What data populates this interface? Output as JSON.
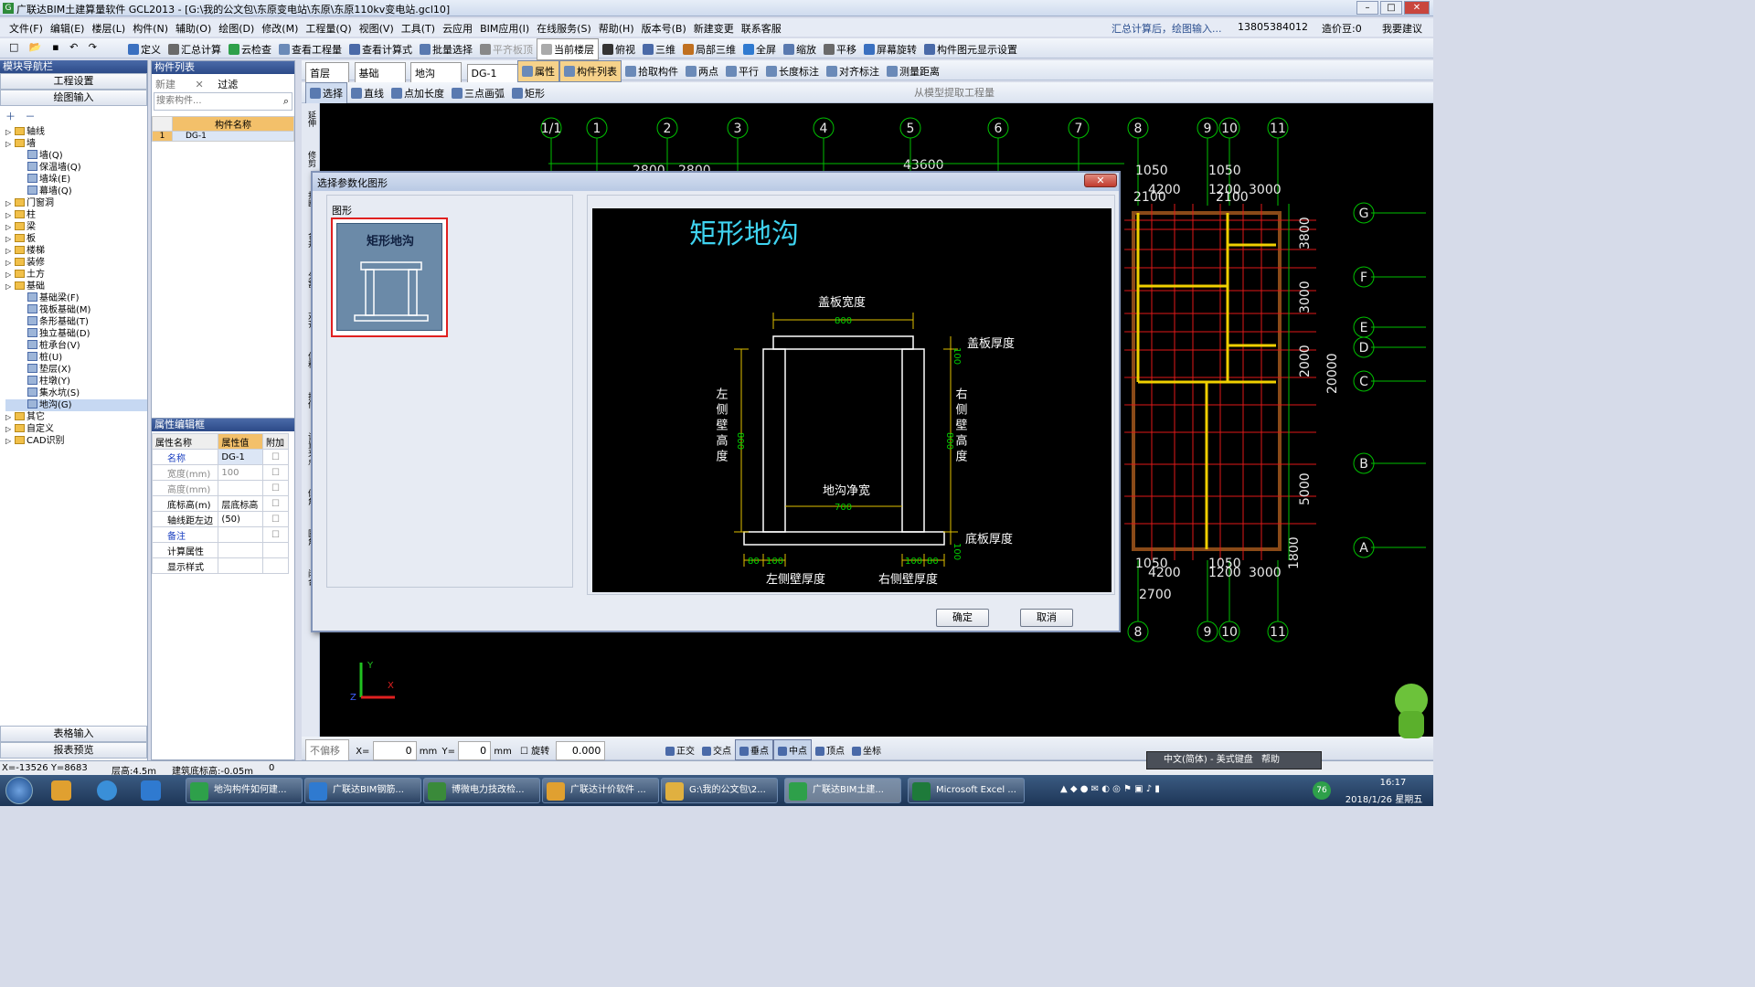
{
  "app": {
    "title": "广联达BIM土建算量软件 GCL2013 - [G:\\我的公文包\\东原变电站\\东原\\东原110kv变电站.gcl10]",
    "window_controls": [
      "–",
      "□",
      "✕"
    ]
  },
  "menu": [
    "文件(F)",
    "编辑(E)",
    "楼层(L)",
    "构件(N)",
    "辅助(O)",
    "绘图(D)",
    "修改(M)",
    "工程量(Q)",
    "视图(V)",
    "工具(T)",
    "云应用",
    "BIM应用(I)",
    "在线服务(S)",
    "帮助(H)",
    "版本号(B)",
    "新建变更",
    "联系客服"
  ],
  "menu_right": {
    "hint": "汇总计算后，绘图输入...",
    "phone": "13805384012",
    "money": "造价豆:0",
    "feedback": "我要建议"
  },
  "toolbar1": [
    "定义",
    "汇总计算",
    "云检查",
    "查看工程量",
    "查看计算式",
    "批量选择",
    "平齐板顶",
    "当前楼层",
    "俯视",
    "三维",
    "局部三维",
    "全屏",
    "缩放",
    "平移",
    "屏幕旋转",
    "构件图元显示设置"
  ],
  "toolbar2": {
    "floor": "首层",
    "category": "基础",
    "type": "地沟",
    "component": "DG-1",
    "items": [
      "属性",
      "构件列表",
      "拾取构件",
      "两点",
      "平行",
      "长度标注",
      "对齐标注",
      "测量距离"
    ]
  },
  "toolbar3": {
    "items": [
      "选择",
      "直线",
      "点加长度",
      "三点画弧",
      "矩形"
    ],
    "extract": "从模型提取工程量"
  },
  "nav": {
    "title": "模块导航栏",
    "buttons": [
      "工程设置",
      "绘图输入"
    ],
    "tree": [
      {
        "label": "轴线",
        "level": 0,
        "kind": "folder"
      },
      {
        "label": "墙",
        "level": 0,
        "kind": "folder"
      },
      {
        "label": "墙(Q)",
        "level": 1,
        "kind": "item"
      },
      {
        "label": "保温墙(Q)",
        "level": 1,
        "kind": "item"
      },
      {
        "label": "墙垛(E)",
        "level": 1,
        "kind": "item"
      },
      {
        "label": "幕墙(Q)",
        "level": 1,
        "kind": "item"
      },
      {
        "label": "门窗洞",
        "level": 0,
        "kind": "folder"
      },
      {
        "label": "柱",
        "level": 0,
        "kind": "folder"
      },
      {
        "label": "梁",
        "level": 0,
        "kind": "folder"
      },
      {
        "label": "板",
        "level": 0,
        "kind": "folder"
      },
      {
        "label": "楼梯",
        "level": 0,
        "kind": "folder"
      },
      {
        "label": "装修",
        "level": 0,
        "kind": "folder"
      },
      {
        "label": "土方",
        "level": 0,
        "kind": "folder"
      },
      {
        "label": "基础",
        "level": 0,
        "kind": "folder"
      },
      {
        "label": "基础梁(F)",
        "level": 1,
        "kind": "item"
      },
      {
        "label": "筏板基础(M)",
        "level": 1,
        "kind": "item"
      },
      {
        "label": "条形基础(T)",
        "level": 1,
        "kind": "item"
      },
      {
        "label": "独立基础(D)",
        "level": 1,
        "kind": "item"
      },
      {
        "label": "桩承台(V)",
        "level": 1,
        "kind": "item"
      },
      {
        "label": "桩(U)",
        "level": 1,
        "kind": "item"
      },
      {
        "label": "垫层(X)",
        "level": 1,
        "kind": "item"
      },
      {
        "label": "柱墩(Y)",
        "level": 1,
        "kind": "item"
      },
      {
        "label": "集水坑(S)",
        "level": 1,
        "kind": "item"
      },
      {
        "label": "地沟(G)",
        "level": 1,
        "kind": "item",
        "selected": true
      },
      {
        "label": "其它",
        "level": 0,
        "kind": "folder"
      },
      {
        "label": "自定义",
        "level": 0,
        "kind": "folder"
      },
      {
        "label": "CAD识别",
        "level": 0,
        "kind": "folder"
      }
    ],
    "bottom_buttons": [
      "表格输入",
      "报表预览"
    ]
  },
  "complist": {
    "title": "构件列表",
    "new_label": "新建",
    "filter_label": "过滤",
    "search_placeholder": "搜索构件...",
    "column": "构件名称",
    "rows": [
      {
        "idx": "1",
        "name": "DG-1"
      }
    ]
  },
  "props": {
    "title": "属性编辑框",
    "headers": [
      "属性名称",
      "属性值",
      "附加"
    ],
    "rows": [
      {
        "name": "名称",
        "value": "DG-1",
        "blue": true
      },
      {
        "name": "宽度(mm)",
        "value": "100",
        "gray": true
      },
      {
        "name": "高度(mm)",
        "value": "",
        "gray": true
      },
      {
        "name": "底标高(m)",
        "value": "层底标高"
      },
      {
        "name": "轴线距左边",
        "value": "(50)"
      },
      {
        "name": "备注",
        "value": "",
        "blue": true
      },
      {
        "name": "计算属性",
        "value": "",
        "group": true
      },
      {
        "name": "显示样式",
        "value": "",
        "group": true
      }
    ]
  },
  "side_tools": [
    "延伸",
    "修剪",
    "打断",
    "合并",
    "分割",
    "对齐",
    "偏移",
    "拉伸",
    "设置夹点",
    "倒角",
    "圆角",
    "闭合"
  ],
  "drawing": {
    "top_axes": [
      "1/1",
      "1",
      "2",
      "3",
      "4",
      "5",
      "6",
      "7",
      "8",
      "9",
      "10",
      "11"
    ],
    "bottom_axes": [
      "8",
      "9",
      "10",
      "11"
    ],
    "right_axes": [
      "G",
      "F",
      "E",
      "D",
      "C",
      "B",
      "A"
    ],
    "dims": {
      "total": "43600",
      "d1": "2800",
      "d2": "2800",
      "d3": "1050",
      "d4": "1050",
      "d5": "4200",
      "d6": "1200",
      "d7": "3000",
      "d8": "2100",
      "d9": "2100",
      "d10": "20000",
      "d11": "2000",
      "d12": "3000",
      "d13": "3800",
      "d14": "1800",
      "d15": "4200",
      "d16": "1200",
      "d17": "3000",
      "d18": "2700",
      "d19": "5000",
      "d20": "1050",
      "d21": "1050"
    }
  },
  "dialog": {
    "title": "选择参数化图形",
    "group_label": "图形",
    "thumb_label": "矩形地沟",
    "preview": {
      "title": "矩形地沟",
      "cover_width_label": "盖板宽度",
      "cover_width": "800",
      "cover_thick_label": "盖板厚度",
      "cover_thick": "100",
      "left_wall_label": "左侧壁高度",
      "left_wall": "800",
      "right_wall_label": "右侧壁高度",
      "right_wall": "800",
      "clear_width_label": "地沟净宽",
      "clear_width": "700",
      "bottom_thick_label": "底板厚度",
      "bottom_thick": "100",
      "left_wall_thick_label": "左侧壁厚度",
      "right_wall_thick_label": "右侧壁厚度",
      "left_dims": [
        "80",
        "100"
      ],
      "right_dims": [
        "100",
        "80"
      ]
    },
    "ok": "确定",
    "cancel": "取消"
  },
  "bottom_toolbar": {
    "mode": "不偏移",
    "x_label": "X=",
    "x_value": "0",
    "y_label": "Y=",
    "y_value": "0",
    "unit": "mm",
    "rotate_label": "旋转",
    "rotate_value": "0.000",
    "snaps": [
      "正交",
      "交点",
      "垂点",
      "中点",
      "顶点",
      "坐标"
    ]
  },
  "status": {
    "coords": "X=-13526  Y=8683",
    "floor_height": "层高:4.5m",
    "base": "建筑底标高:-0.05m",
    "value": "0"
  },
  "ime": {
    "label": "中文(简体) - 美式键盘",
    "help": "帮助"
  },
  "taskbar": {
    "tasks": [
      "地沟构件如何建...",
      "广联达BIM钢筋...",
      "博微电力技改检...",
      "广联达计价软件 ...",
      "G:\\我的公文包\\2...",
      "广联达BIM土建...",
      "Microsoft Excel ..."
    ],
    "time": "16:17",
    "date": "2018/1/26 星期五",
    "badge": "76"
  },
  "colors": {
    "canvas": "#000000",
    "axis": "#00c000",
    "grid_red": "#e01818",
    "wall_yellow": "#f0d000",
    "beam_brown": "#8a4a18",
    "dim_white": "#e8e8e8",
    "title_cyan": "#3fd3f0"
  }
}
